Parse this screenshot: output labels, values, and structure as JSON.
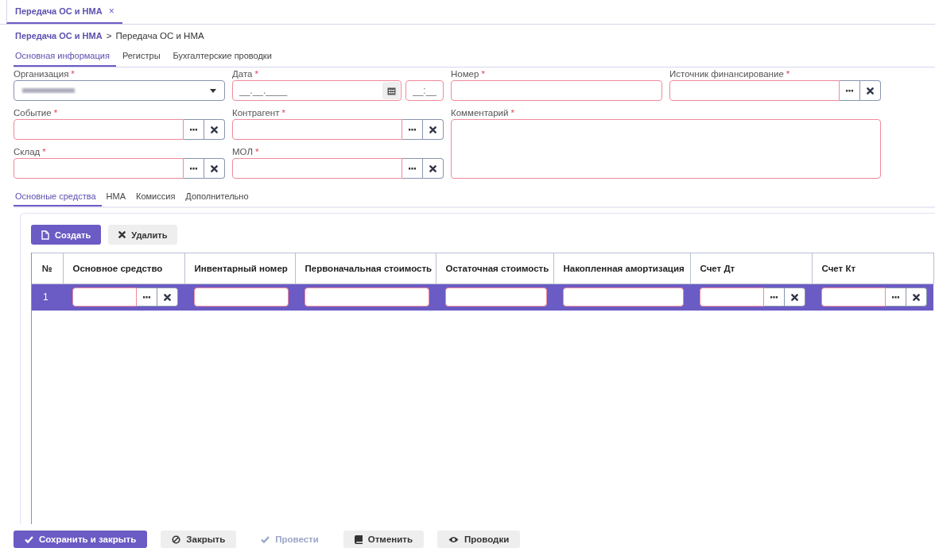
{
  "document_tabs": [
    {
      "label": "Передача ОС и НМА",
      "close": "×",
      "selected": true
    }
  ],
  "breadcrumb": {
    "link": "Передача ОС и НМА",
    "separator": ">",
    "current": "Передача ОС и НМА"
  },
  "tabs": [
    {
      "label": "Основная информация",
      "selected": true
    },
    {
      "label": "Регистры",
      "selected": false
    },
    {
      "label": "Бухгалтерские проводки",
      "selected": false
    }
  ],
  "fields": [
    {
      "label": "Организация",
      "required_mark": "*",
      "kind": "select",
      "invalid": false
    },
    {
      "label": "Дата",
      "required_mark": "*",
      "kind": "date",
      "invalid": true,
      "placeholder": "__.__.____",
      "time_placeholder": "__:__"
    },
    {
      "label": "Номер",
      "required_mark": "*",
      "kind": "text",
      "invalid": true
    },
    {
      "label": "Источник финансирование",
      "required_mark": "*",
      "kind": "lookup",
      "invalid": true
    },
    {
      "label": "Событие",
      "required_mark": "*",
      "kind": "lookup",
      "invalid": true
    },
    {
      "label": "Контрагент",
      "required_mark": "*",
      "kind": "lookup",
      "invalid": true
    },
    {
      "label": "Комментарий",
      "required_mark": "*",
      "kind": "textarea",
      "invalid": true
    },
    {
      "label": "Склад",
      "required_mark": "*",
      "kind": "lookup",
      "invalid": true
    },
    {
      "label": "МОЛ",
      "required_mark": "*",
      "kind": "lookup",
      "invalid": true
    }
  ],
  "sub_tabs": [
    {
      "label": "Основные средства",
      "selected": true
    },
    {
      "label": "НМА",
      "selected": false
    },
    {
      "label": "Комиссия",
      "selected": false
    },
    {
      "label": "Дополнительно",
      "selected": false
    }
  ],
  "toolbar": [
    {
      "label": "Создать",
      "primary": true
    },
    {
      "label": "Удалить",
      "primary": false
    }
  ],
  "table": {
    "columns": [
      "№",
      "Основное средство",
      "Инвентарный номер",
      "Первоначальная стоимость",
      "Остаточная стоимость",
      "Накопленная амортизация",
      "Счет Дт",
      "Счет Кт"
    ],
    "rows": [
      {
        "number": "1",
        "selected": true,
        "cells": [
          {
            "kind": "lookup",
            "invalid": true
          },
          {
            "kind": "text",
            "invalid": true
          },
          {
            "kind": "text",
            "invalid": true
          },
          {
            "kind": "text",
            "invalid": true
          },
          {
            "kind": "text",
            "invalid": true
          },
          {
            "kind": "lookup",
            "invalid": true
          },
          {
            "kind": "lookup",
            "invalid": true
          }
        ]
      }
    ]
  },
  "footer_buttons": [
    {
      "label": "Сохранить и закрыть",
      "primary": true,
      "disabled": false
    },
    {
      "label": "Закрыть",
      "primary": false,
      "disabled": false
    },
    {
      "label": "Провести",
      "primary": false,
      "disabled": true
    },
    {
      "label": "Отменить",
      "primary": false,
      "disabled": false
    },
    {
      "label": "Проводки",
      "primary": false,
      "disabled": false
    }
  ]
}
